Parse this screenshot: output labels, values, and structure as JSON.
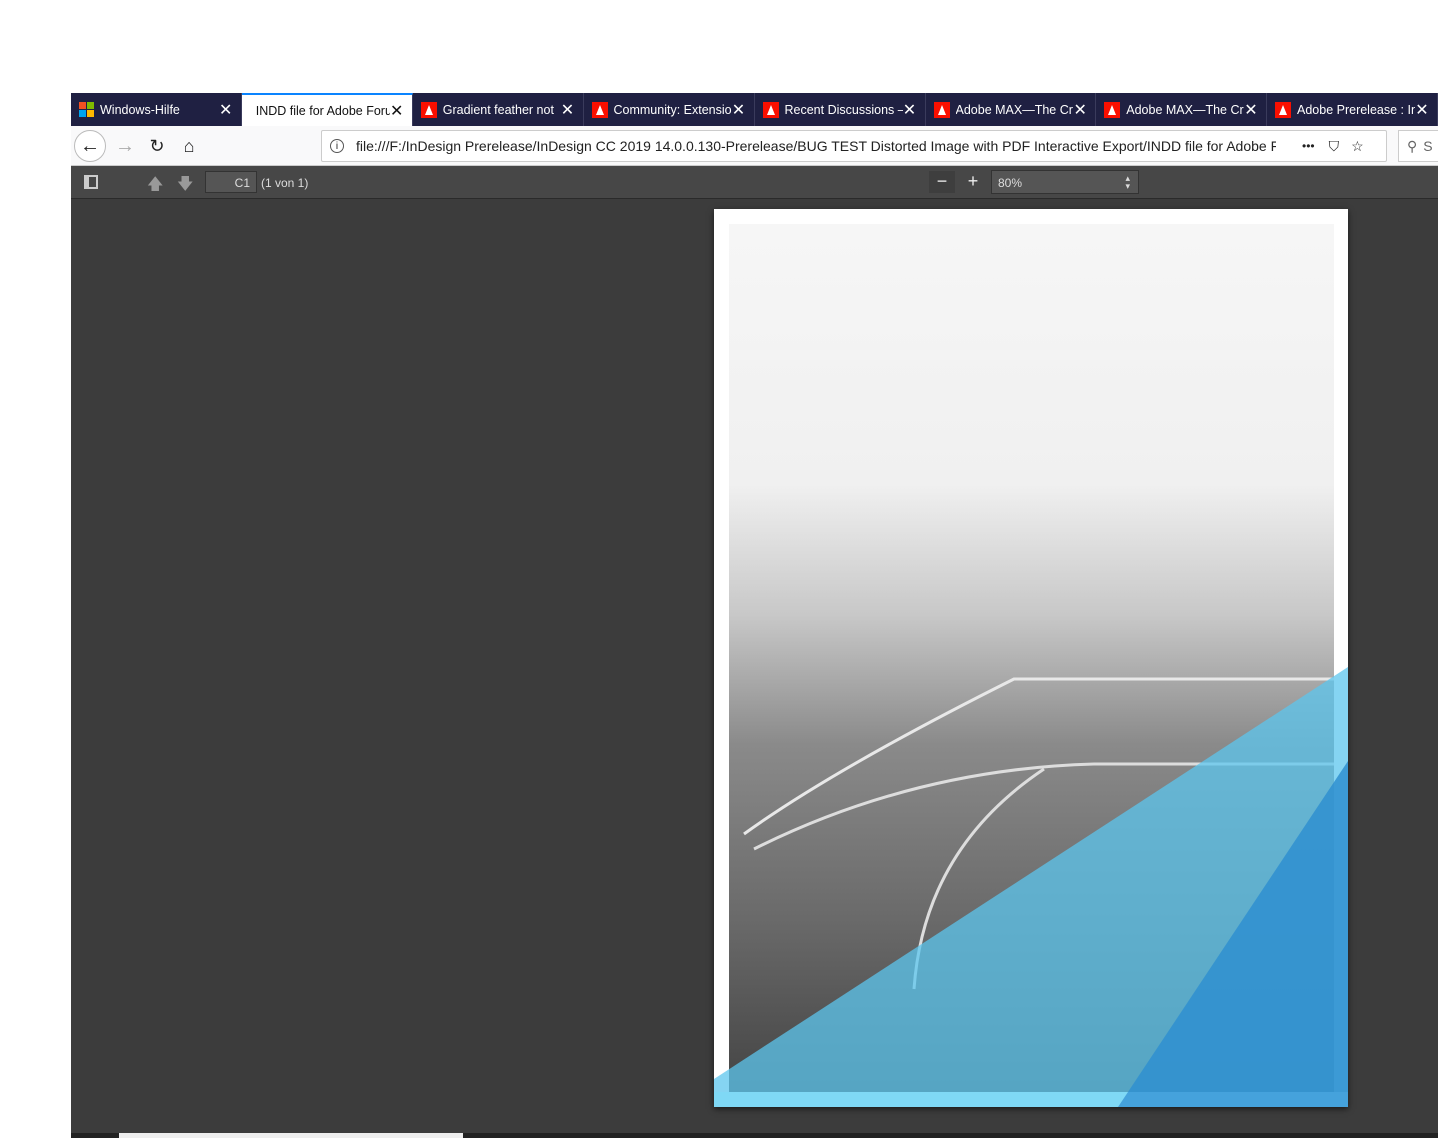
{
  "tabs": [
    {
      "label": "Windows-Hilfe",
      "icon": "windows-logo-icon"
    },
    {
      "label": "INDD file for Adobe Forum",
      "icon": "none",
      "active": true
    },
    {
      "label": "Gradient feather not",
      "icon": "adobe-icon"
    },
    {
      "label": "Community: Extensio",
      "icon": "adobe-icon"
    },
    {
      "label": "Recent Discussions –",
      "icon": "adobe-icon"
    },
    {
      "label": "Adobe MAX—The Cr",
      "icon": "adobe-icon"
    },
    {
      "label": "Adobe MAX—The Cr",
      "icon": "adobe-icon"
    },
    {
      "label": "Adobe Prerelease : In",
      "icon": "adobe-icon"
    }
  ],
  "nav": {
    "url": "file:///F:/InDesign Prerelease/InDesign CC 2019 14.0.0.130-Prerelease/BUG TEST Distorted Image with PDF Interactive Export/INDD file for Adobe Forum",
    "search_placeholder": "S",
    "more": "•••"
  },
  "pdf": {
    "page_value": "C1",
    "page_count": "(1 von 1)",
    "zoom": "80%",
    "zoom_out": "−",
    "zoom_in": "+"
  },
  "colors": {
    "tab_bar": "#1f2042",
    "accent": "#0a84ff",
    "blue_light": "#7fd8f5",
    "blue_dark": "#3d9fd8"
  }
}
